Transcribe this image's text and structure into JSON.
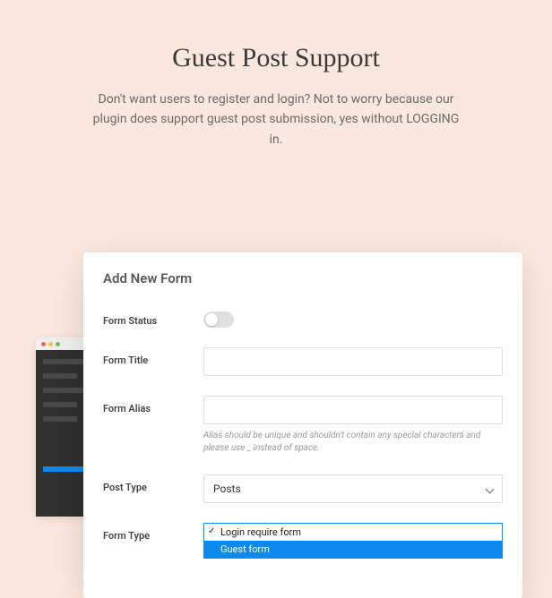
{
  "hero": {
    "title": "Guest Post Support",
    "description": "Don't want users to register and login? Not to worry because our plugin does support guest post submission, yes without LOGGING in."
  },
  "modal": {
    "title": "Add New Form",
    "fields": {
      "status_label": "Form Status",
      "title_label": "Form Title",
      "alias_label": "Form Alias",
      "alias_helper": "Alias should be unique and shouldn't contain any special characters and please use _ instead of space.",
      "post_type_label": "Post Type",
      "post_type_value": "Posts",
      "form_type_label": "Form Type",
      "form_type_options": {
        "option1": "Login require form",
        "option2": "Guest form"
      }
    }
  }
}
